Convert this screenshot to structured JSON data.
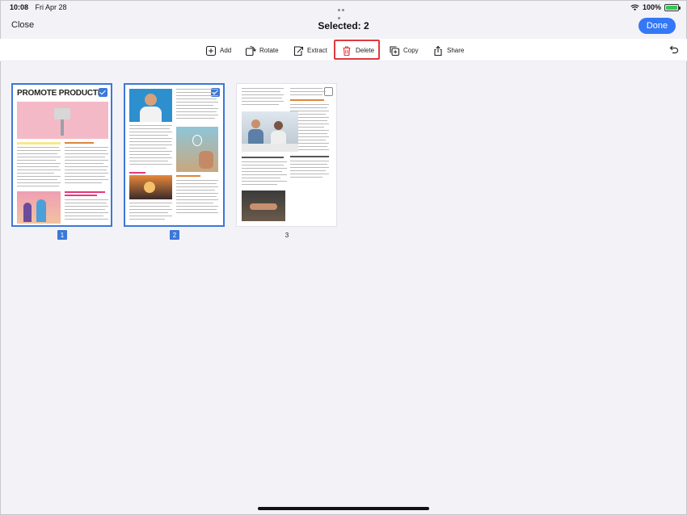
{
  "status": {
    "time": "10:08",
    "date": "Fri Apr 28",
    "battery": "100%",
    "battery_level": 1.0
  },
  "nav": {
    "close": "Close",
    "title": "Selected: 2",
    "done": "Done"
  },
  "toolbar": {
    "add": "Add",
    "rotate": "Rotate",
    "extract": "Extract",
    "delete": "Delete",
    "copy": "Copy",
    "share": "Share"
  },
  "pages": [
    {
      "number": "1",
      "selected": true,
      "title": "PROMOTE PRODUCTIVITY"
    },
    {
      "number": "2",
      "selected": true
    },
    {
      "number": "3",
      "selected": false
    }
  ],
  "colors": {
    "accent": "#3478f6",
    "selection": "#3b78d8",
    "highlight": "#e0383e"
  }
}
